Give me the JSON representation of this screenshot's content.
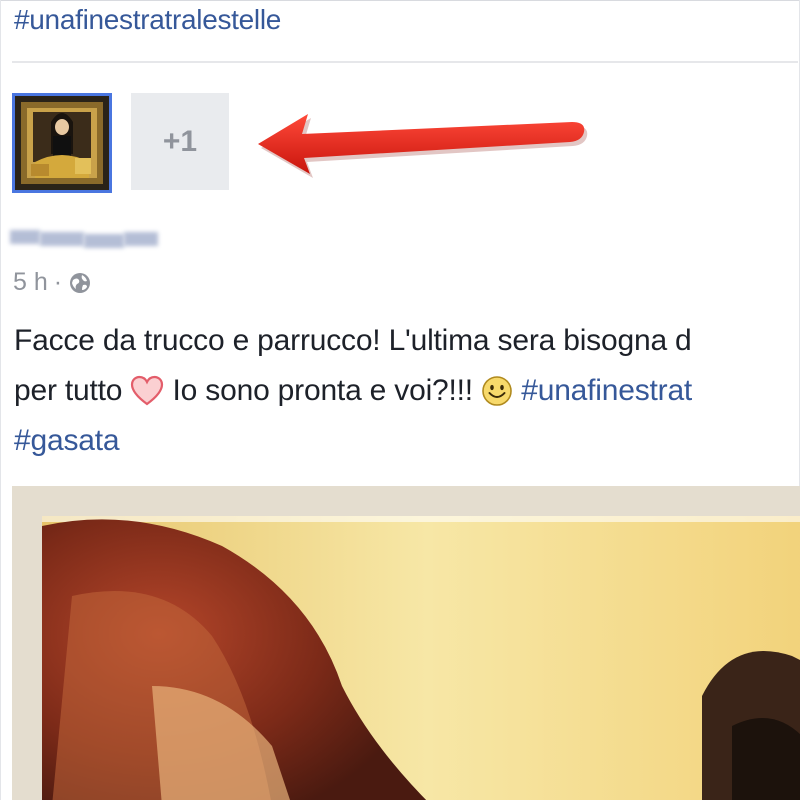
{
  "post_header": {
    "hashtag_top": "#unafinestratralestelle"
  },
  "tagged": {
    "avatar_icon": "profile-photo",
    "more_count_label": "+1"
  },
  "annotation": {
    "arrow_color": "#e8261c",
    "arrow_icon": "red-arrow-pointing-left"
  },
  "post": {
    "time": "5 h",
    "separator": "·",
    "audience_icon": "globe-icon",
    "text_line1": "Facce da trucco e parrucco! L'ultima sera bisogna d",
    "text_line2_a": "per tutto ",
    "text_line2_b": " Io sono pronta e voi?!!! ",
    "text_line2_hashtag": "#unafinestrat",
    "text_line3_hashtag": "#gasata",
    "heart_icon": "heart-emoji",
    "smile_icon": "smile-emoji"
  },
  "colors": {
    "link": "#365899",
    "text": "#1d2129",
    "meta": "#90949c",
    "tile_bg": "#e9ebee",
    "avatar_border": "#4a76e0"
  }
}
